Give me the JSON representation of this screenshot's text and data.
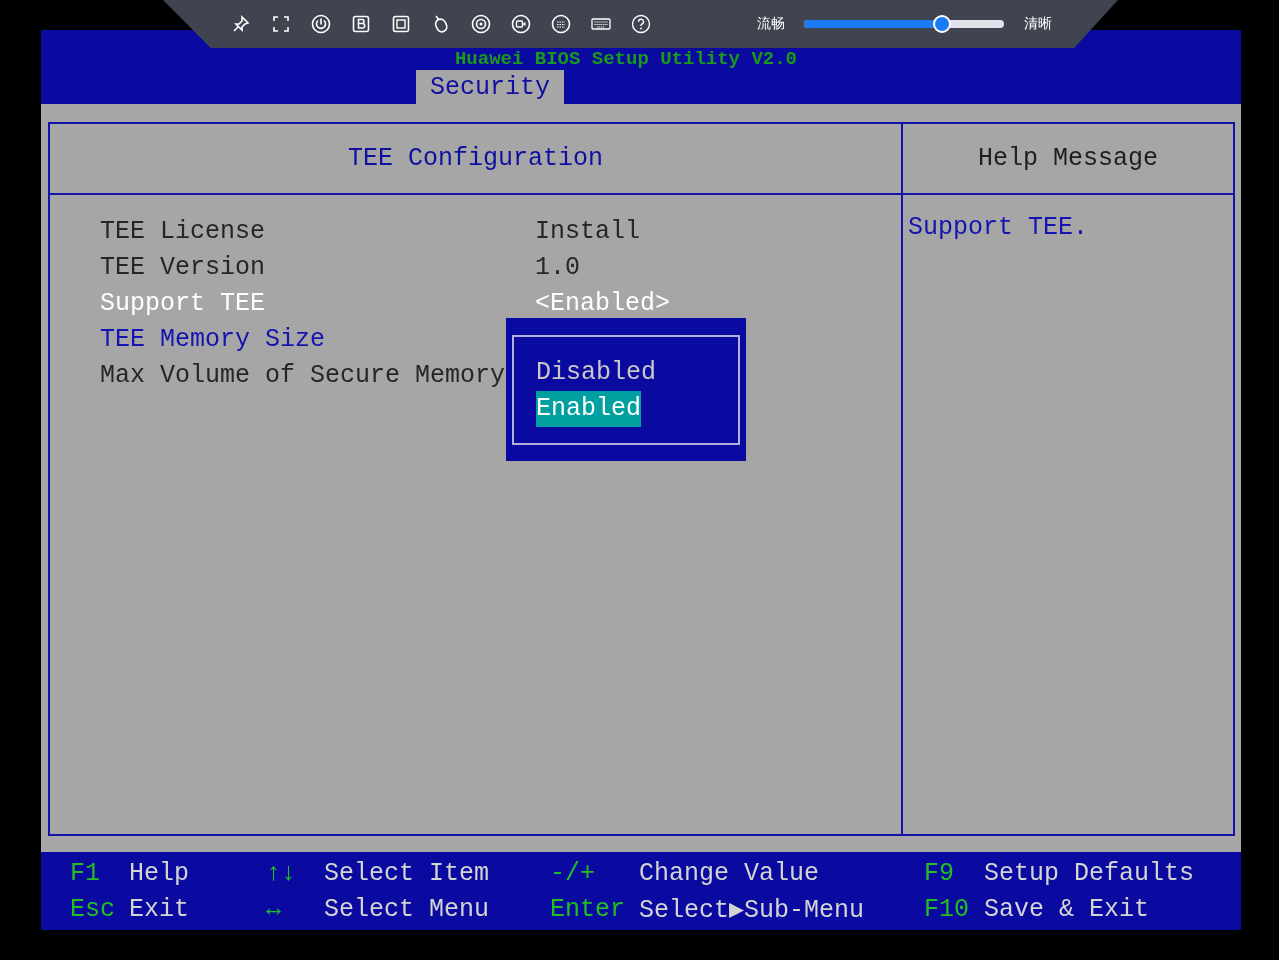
{
  "toolbar": {
    "left_label": "流畅",
    "right_label": "清晰",
    "level": 0.69
  },
  "header": {
    "title": "Huawei BIOS Setup Utility V2.0",
    "tabs": [
      {
        "label": "Security",
        "selected": true
      }
    ]
  },
  "panel": {
    "title": "TEE Configuration",
    "items": [
      {
        "label": "TEE License",
        "value": "Install",
        "kind": "info",
        "selected": false
      },
      {
        "label": "TEE Version",
        "value": "1.0",
        "kind": "info",
        "selected": false
      },
      {
        "label": "Support TEE",
        "value": "<Enabled>",
        "kind": "option",
        "selected": true
      },
      {
        "label": "TEE Memory Size",
        "kind": "option",
        "selected": false
      },
      {
        "label": "Max Volume of Secure Memory",
        "kind": "info",
        "selected": false
      }
    ]
  },
  "popup": {
    "options": [
      {
        "label": "Disabled",
        "selected": false
      },
      {
        "label": "Enabled",
        "selected": true
      }
    ]
  },
  "help": {
    "title": "Help Message",
    "text": "Support TEE."
  },
  "footer": {
    "keys": [
      {
        "key": "F1",
        "action": "Help"
      },
      {
        "key": "↑↓",
        "action": "Select Item"
      },
      {
        "key": "-/+",
        "action": "Change Value"
      },
      {
        "key": "F9",
        "action": "Setup Defaults"
      },
      {
        "key": "Esc",
        "action": "Exit"
      },
      {
        "key": "↔",
        "action": "Select Menu"
      },
      {
        "key": "Enter",
        "action": "Select▶Sub-Menu"
      },
      {
        "key": "F10",
        "action": "Save & Exit"
      }
    ]
  }
}
